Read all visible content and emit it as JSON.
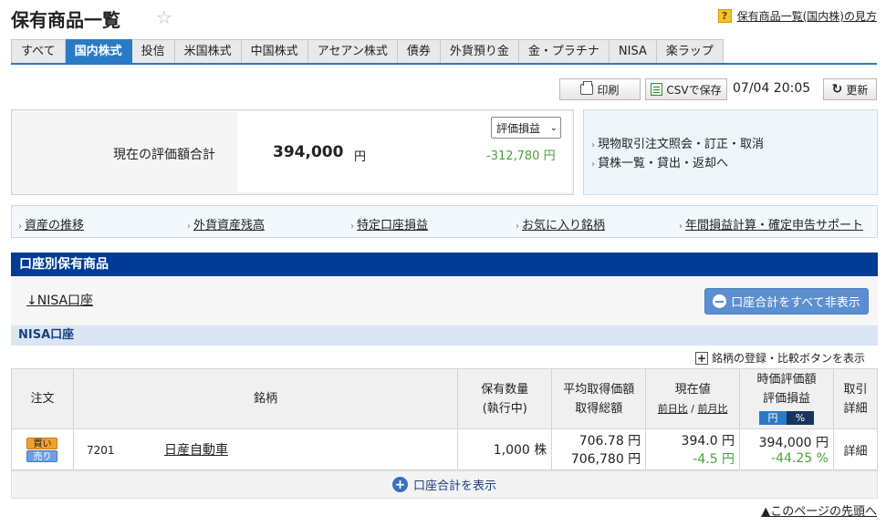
{
  "header": {
    "title": "保有商品一覧",
    "star_icon": "star-icon",
    "help_icon": "?",
    "help_link": "保有商品一覧(国内株)の見方"
  },
  "tabs": [
    {
      "label": "すべて"
    },
    {
      "label": "国内株式",
      "active": true
    },
    {
      "label": "投信"
    },
    {
      "label": "米国株式"
    },
    {
      "label": "中国株式"
    },
    {
      "label": "アセアン株式"
    },
    {
      "label": "債券"
    },
    {
      "label": "外貨預り金"
    },
    {
      "label": "金・プラチナ"
    },
    {
      "label": "NISA"
    },
    {
      "label": "楽ラップ"
    }
  ],
  "toolbar": {
    "print_label": "印刷",
    "csv_label": "CSVで保存",
    "timestamp": "07/04 20:05",
    "refresh_label": "更新"
  },
  "summary": {
    "label": "現在の評価額合計",
    "value": "394,000",
    "unit": "円",
    "select_value": "評価損益",
    "gain": "-312,780 円",
    "links": [
      "現物取引注文照会・訂正・取消",
      "貸株一覧・貸出・返却へ"
    ]
  },
  "link_bar": [
    "資産の推移",
    "外貨資産残高",
    "特定口座損益",
    "お気に入り銘柄",
    "年間損益計算・確定申告サポート"
  ],
  "section": {
    "title": "口座別保有商品",
    "nisa_jump": "↓NISA口座",
    "hide_all_button": "口座合計をすべて非表示",
    "account_header": "NISA口座",
    "compare_link": "銘柄の登録・比較ボタンを表示"
  },
  "table": {
    "headers": {
      "order": "注文",
      "name": "銘柄",
      "qty_line1": "保有数量",
      "qty_line2": "(執行中)",
      "avg_line1": "平均取得価額",
      "avg_line2": "取得総額",
      "price_line1": "現在値",
      "price_prev_day": "前日比",
      "price_sep": " / ",
      "price_prev_month": "前月比",
      "eval_line1": "時価評価額",
      "eval_line2": "評価損益",
      "toggle_yen": "円",
      "toggle_pct": "%",
      "detail_line1": "取引",
      "detail_line2": "詳細"
    },
    "rows": [
      {
        "buy": "買い",
        "sell": "売り",
        "code": "7201",
        "name": "日産自動車",
        "qty": "1,000 株",
        "avg_price": "706.78 円",
        "avg_total": "706,780 円",
        "current": "394.0 円",
        "change": "-4.5 円",
        "eval_value": "394,000 円",
        "eval_gain": "-44.25 %",
        "detail": "詳細"
      }
    ]
  },
  "show_total": "口座合計を表示",
  "to_top": "▲このページの先頭へ",
  "colors": {
    "tab_active": "#2a7ac6",
    "section_header": "#003b95",
    "gain_green": "#4aa13a"
  }
}
